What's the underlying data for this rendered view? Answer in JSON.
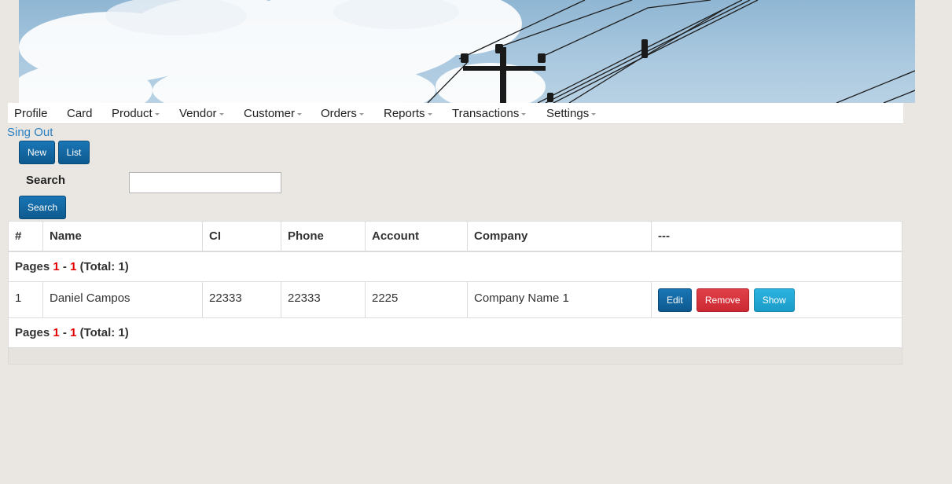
{
  "nav": {
    "items": [
      {
        "label": "Profile",
        "dropdown": false
      },
      {
        "label": "Card",
        "dropdown": false
      },
      {
        "label": "Product",
        "dropdown": true
      },
      {
        "label": "Vendor",
        "dropdown": true
      },
      {
        "label": "Customer",
        "dropdown": true
      },
      {
        "label": "Orders",
        "dropdown": true
      },
      {
        "label": "Reports",
        "dropdown": true
      },
      {
        "label": "Transactions",
        "dropdown": true
      },
      {
        "label": "Settings",
        "dropdown": true
      }
    ],
    "signout": "Sing Out"
  },
  "toolbar": {
    "new_label": "New",
    "list_label": "List"
  },
  "search": {
    "label": "Search",
    "value": "",
    "placeholder": "",
    "button_label": "Search"
  },
  "table": {
    "headers": [
      "#",
      "Name",
      "CI",
      "Phone",
      "Account",
      "Company",
      "---"
    ],
    "pagination": {
      "prefix": "Pages",
      "from": "1",
      "separator": "-",
      "to": "1",
      "total": "(Total: 1)"
    },
    "rows": [
      {
        "num": "1",
        "name": "Daniel Campos",
        "ci": "22333",
        "phone": "22333",
        "account": "2225",
        "company": "Company Name 1"
      }
    ],
    "actions": {
      "edit": "Edit",
      "remove": "Remove",
      "show": "Show"
    }
  },
  "colors": {
    "primary": "#0e5a8f",
    "danger": "#cc2a33",
    "info": "#1b9cc8",
    "page_number": "#e00000",
    "link": "#2a7fc0"
  }
}
